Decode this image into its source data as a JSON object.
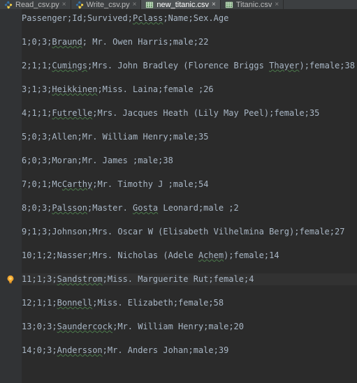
{
  "tabs": [
    {
      "label": "Read_csv.py",
      "type": "py",
      "active": false
    },
    {
      "label": "Write_csv.py",
      "type": "py",
      "active": false
    },
    {
      "label": "new_titanic.csv",
      "type": "csv",
      "active": true
    },
    {
      "label": "Titanic.csv",
      "type": "csv",
      "active": false
    }
  ],
  "caret_row_index": 22,
  "lines": [
    {
      "kind": "row",
      "segs": [
        {
          "t": "Passenger"
        },
        {
          "t": ";"
        },
        {
          "t": "Id"
        },
        {
          "t": ";"
        },
        {
          "t": "Survived"
        },
        {
          "t": ";"
        },
        {
          "t": "Pclass",
          "u": true
        },
        {
          "t": ";"
        },
        {
          "t": "Name"
        },
        {
          "t": ";"
        },
        {
          "t": "Sex.Age"
        }
      ]
    },
    {
      "kind": "blank"
    },
    {
      "kind": "row",
      "segs": [
        {
          "t": "1"
        },
        {
          "t": ";"
        },
        {
          "t": "0"
        },
        {
          "t": ";"
        },
        {
          "t": "3"
        },
        {
          "t": ";"
        },
        {
          "t": "Braund",
          "u": true
        },
        {
          "t": ";"
        },
        {
          "t": " Mr. Owen Harris"
        },
        {
          "t": ";"
        },
        {
          "t": "male"
        },
        {
          "t": ";"
        },
        {
          "t": "22"
        }
      ]
    },
    {
      "kind": "blank"
    },
    {
      "kind": "row",
      "segs": [
        {
          "t": "2"
        },
        {
          "t": ";"
        },
        {
          "t": "1"
        },
        {
          "t": ";"
        },
        {
          "t": "1"
        },
        {
          "t": ";"
        },
        {
          "t": "Cumings",
          "u": true
        },
        {
          "t": ";"
        },
        {
          "t": "Mrs. John Bradley (Florence Briggs "
        },
        {
          "t": "Thayer",
          "u": true
        },
        {
          "t": ")"
        },
        {
          "t": ";"
        },
        {
          "t": "female"
        },
        {
          "t": ";"
        },
        {
          "t": "38"
        }
      ]
    },
    {
      "kind": "blank"
    },
    {
      "kind": "row",
      "segs": [
        {
          "t": "3"
        },
        {
          "t": ";"
        },
        {
          "t": "1"
        },
        {
          "t": ";"
        },
        {
          "t": "3"
        },
        {
          "t": ";"
        },
        {
          "t": "Heikkinen",
          "u": true
        },
        {
          "t": ";"
        },
        {
          "t": "Miss. Laina"
        },
        {
          "t": ";"
        },
        {
          "t": "female "
        },
        {
          "t": ";"
        },
        {
          "t": "26"
        }
      ]
    },
    {
      "kind": "blank"
    },
    {
      "kind": "row",
      "segs": [
        {
          "t": "4"
        },
        {
          "t": ";"
        },
        {
          "t": "1"
        },
        {
          "t": ";"
        },
        {
          "t": "1"
        },
        {
          "t": ";"
        },
        {
          "t": "Futrelle",
          "u": true
        },
        {
          "t": ";"
        },
        {
          "t": "Mrs. Jacques Heath (Lily May Peel)"
        },
        {
          "t": ";"
        },
        {
          "t": "female"
        },
        {
          "t": ";"
        },
        {
          "t": "35"
        }
      ]
    },
    {
      "kind": "blank"
    },
    {
      "kind": "row",
      "segs": [
        {
          "t": "5"
        },
        {
          "t": ";"
        },
        {
          "t": "0"
        },
        {
          "t": ";"
        },
        {
          "t": "3"
        },
        {
          "t": ";"
        },
        {
          "t": "Allen"
        },
        {
          "t": ";"
        },
        {
          "t": "Mr. William Henry"
        },
        {
          "t": ";"
        },
        {
          "t": "male"
        },
        {
          "t": ";"
        },
        {
          "t": "35"
        }
      ]
    },
    {
      "kind": "blank"
    },
    {
      "kind": "row",
      "segs": [
        {
          "t": "6"
        },
        {
          "t": ";"
        },
        {
          "t": "0"
        },
        {
          "t": ";"
        },
        {
          "t": "3"
        },
        {
          "t": ";"
        },
        {
          "t": "Moran"
        },
        {
          "t": ";"
        },
        {
          "t": "Mr. James "
        },
        {
          "t": ";"
        },
        {
          "t": "male"
        },
        {
          "t": ";"
        },
        {
          "t": "38"
        }
      ]
    },
    {
      "kind": "blank"
    },
    {
      "kind": "row",
      "segs": [
        {
          "t": "7"
        },
        {
          "t": ";"
        },
        {
          "t": "0"
        },
        {
          "t": ";"
        },
        {
          "t": "1"
        },
        {
          "t": ";"
        },
        {
          "t": "Mc"
        },
        {
          "t": "Carthy",
          "u": true
        },
        {
          "t": ";"
        },
        {
          "t": "Mr. Timothy J "
        },
        {
          "t": ";"
        },
        {
          "t": "male"
        },
        {
          "t": ";"
        },
        {
          "t": "54"
        }
      ]
    },
    {
      "kind": "blank"
    },
    {
      "kind": "row",
      "segs": [
        {
          "t": "8"
        },
        {
          "t": ";"
        },
        {
          "t": "0"
        },
        {
          "t": ";"
        },
        {
          "t": "3"
        },
        {
          "t": ";"
        },
        {
          "t": "Palsson",
          "u": true
        },
        {
          "t": ";"
        },
        {
          "t": "Master. "
        },
        {
          "t": "Gosta",
          "u": true
        },
        {
          "t": " Leonard"
        },
        {
          "t": ";"
        },
        {
          "t": "male "
        },
        {
          "t": ";"
        },
        {
          "t": "2"
        }
      ]
    },
    {
      "kind": "blank"
    },
    {
      "kind": "row",
      "segs": [
        {
          "t": "9"
        },
        {
          "t": ";"
        },
        {
          "t": "1"
        },
        {
          "t": ";"
        },
        {
          "t": "3"
        },
        {
          "t": ";"
        },
        {
          "t": "Johnson"
        },
        {
          "t": ";"
        },
        {
          "t": "Mrs. Oscar W (Elisabeth Vilhelmina Berg)"
        },
        {
          "t": ";"
        },
        {
          "t": "female"
        },
        {
          "t": ";"
        },
        {
          "t": "27"
        }
      ]
    },
    {
      "kind": "blank"
    },
    {
      "kind": "row",
      "segs": [
        {
          "t": "10"
        },
        {
          "t": ";"
        },
        {
          "t": "1"
        },
        {
          "t": ";"
        },
        {
          "t": "2"
        },
        {
          "t": ";"
        },
        {
          "t": "Nasser"
        },
        {
          "t": ";"
        },
        {
          "t": "Mrs. Nicholas (Adele "
        },
        {
          "t": "Achem",
          "u": true
        },
        {
          "t": ")"
        },
        {
          "t": ";"
        },
        {
          "t": "female"
        },
        {
          "t": ";"
        },
        {
          "t": "14"
        }
      ]
    },
    {
      "kind": "blank"
    },
    {
      "kind": "row",
      "segs": [
        {
          "t": "11"
        },
        {
          "t": ";"
        },
        {
          "t": "1"
        },
        {
          "t": ";"
        },
        {
          "t": "3"
        },
        {
          "t": ";"
        },
        {
          "t": "Sandstrom",
          "u": true
        },
        {
          "t": ";"
        },
        {
          "t": "Miss. Marguerite Rut"
        },
        {
          "t": ";"
        },
        {
          "t": "female"
        },
        {
          "t": ";"
        },
        {
          "t": "4"
        }
      ]
    },
    {
      "kind": "blank"
    },
    {
      "kind": "row",
      "segs": [
        {
          "t": "12"
        },
        {
          "t": ";"
        },
        {
          "t": "1"
        },
        {
          "t": ";"
        },
        {
          "t": "1"
        },
        {
          "t": ";"
        },
        {
          "t": "Bonnell",
          "u": true
        },
        {
          "t": ";"
        },
        {
          "t": "Miss. Elizabeth"
        },
        {
          "t": ";"
        },
        {
          "t": "female"
        },
        {
          "t": ";"
        },
        {
          "t": "58"
        }
      ]
    },
    {
      "kind": "blank"
    },
    {
      "kind": "row",
      "segs": [
        {
          "t": "13"
        },
        {
          "t": ";"
        },
        {
          "t": "0"
        },
        {
          "t": ";"
        },
        {
          "t": "3"
        },
        {
          "t": ";"
        },
        {
          "t": "Saundercock",
          "u": true
        },
        {
          "t": ";"
        },
        {
          "t": "Mr. William Henry"
        },
        {
          "t": ";"
        },
        {
          "t": "male"
        },
        {
          "t": ";"
        },
        {
          "t": "20"
        }
      ]
    },
    {
      "kind": "blank"
    },
    {
      "kind": "row",
      "segs": [
        {
          "t": "14"
        },
        {
          "t": ";"
        },
        {
          "t": "0"
        },
        {
          "t": ";"
        },
        {
          "t": "3"
        },
        {
          "t": ";"
        },
        {
          "t": "Andersson",
          "u": true
        },
        {
          "t": ";"
        },
        {
          "t": "Mr. Anders Johan"
        },
        {
          "t": ";"
        },
        {
          "t": "male"
        },
        {
          "t": ";"
        },
        {
          "t": "39"
        }
      ]
    }
  ]
}
